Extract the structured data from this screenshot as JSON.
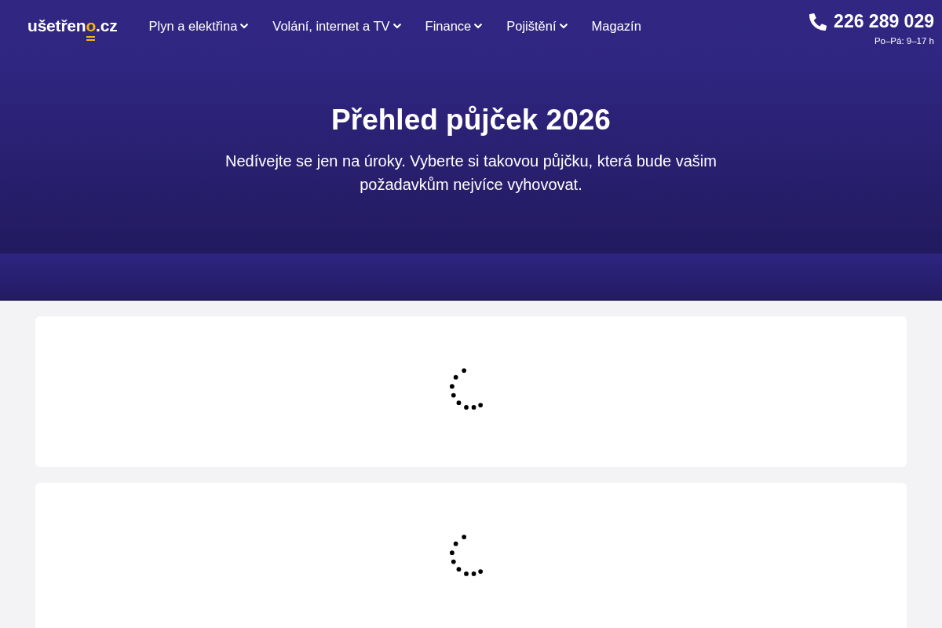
{
  "header": {
    "logo": {
      "lead": "ušetřen",
      "accent": "o",
      "tail": ".cz"
    },
    "nav": [
      {
        "label": "Plyn a elektřina",
        "dropdown": true
      },
      {
        "label": "Volání, internet a TV",
        "dropdown": true
      },
      {
        "label": "Finance",
        "dropdown": true
      },
      {
        "label": "Pojištění",
        "dropdown": true
      },
      {
        "label": "Magazín",
        "dropdown": false
      }
    ],
    "contact": {
      "phone": "226 289 029",
      "hours": "Po–Pá: 9–17 h"
    }
  },
  "hero": {
    "title": "Přehled půjček 2026",
    "subtitle": "Nedívejte se jen na úroky. Vyberte si takovou půjčku, která bude vašim požadavkům nejvíce vyhovovat."
  },
  "cards": [
    {
      "loading": true
    },
    {
      "loading": true
    }
  ]
}
